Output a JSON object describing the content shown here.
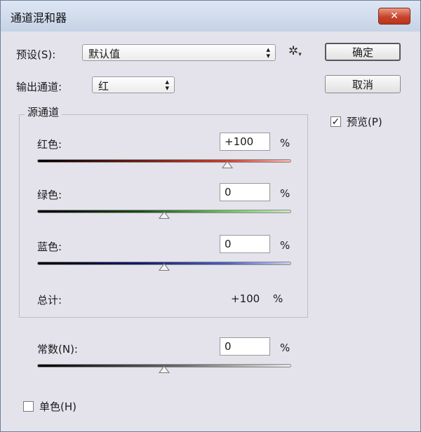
{
  "window": {
    "title": "通道混和器",
    "close_label": "✕"
  },
  "preset": {
    "label": "预设(S):",
    "value": "默认值"
  },
  "output": {
    "label": "输出通道:",
    "value": "红"
  },
  "buttons": {
    "ok": "确定",
    "cancel": "取消"
  },
  "preview": {
    "label": "预览(P)",
    "checked": true
  },
  "source": {
    "title": "源通道",
    "channels": [
      {
        "label": "红色:",
        "value": "+100",
        "unit": "%",
        "slider_fraction": 0.75
      },
      {
        "label": "绿色:",
        "value": "0",
        "unit": "%",
        "slider_fraction": 0.5
      },
      {
        "label": "蓝色:",
        "value": "0",
        "unit": "%",
        "slider_fraction": 0.5
      }
    ],
    "total": {
      "label": "总计:",
      "value": "+100",
      "unit": "%"
    }
  },
  "constant": {
    "label": "常数(N):",
    "value": "0",
    "unit": "%",
    "slider_fraction": 0.5
  },
  "monochrome": {
    "label": "单色(H)",
    "checked": false
  },
  "icons": {
    "gear": "gear-icon",
    "close": "close-icon",
    "check": "checkmark-icon"
  }
}
